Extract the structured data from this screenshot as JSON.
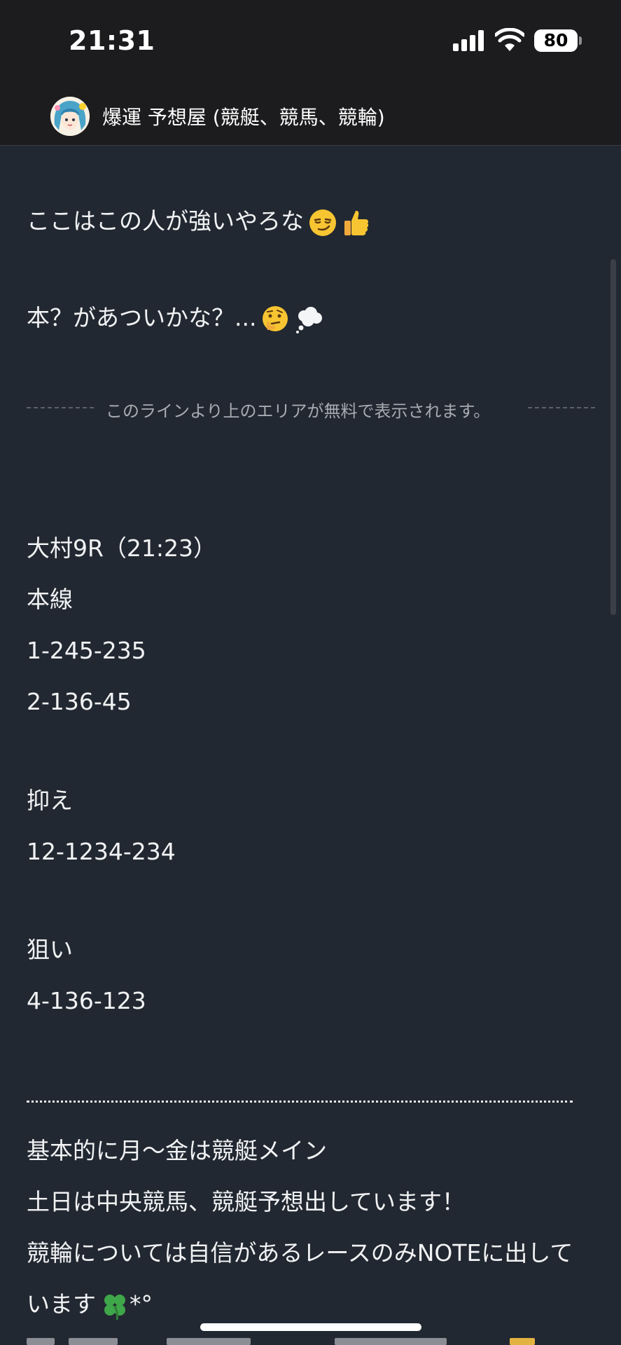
{
  "status_bar": {
    "time": "21:31",
    "battery_level": "80",
    "signal_icon": "cellular-signal-icon",
    "wifi_icon": "wifi-icon",
    "battery_icon": "battery-icon"
  },
  "channel": {
    "name": "爆運 予想屋 (競艇、競馬、競輪)",
    "avatar_icon": "anime-girl-avatar"
  },
  "post": {
    "intro_line_1": "ここはこの人が強いやろな",
    "intro_line_1_emojis": [
      "smirk-emoji",
      "thumbs-up-emoji"
    ],
    "intro_line_2": "本？があついかな？...",
    "intro_line_2_emojis": [
      "thinking-face-emoji",
      "thought-balloon-emoji"
    ],
    "free_area_notice": "このラインより上のエリアが無料で表示されます。",
    "race_title": "大村9R（21:23）",
    "main_label": "本線",
    "main_bet_1": "1-245-235",
    "main_bet_2": "2-136-45",
    "cover_label": "抑え",
    "cover_bet_1": "12-1234-234",
    "target_label": "狙い",
    "target_bet_1": "4-136-123",
    "info_line_1": "基本的に月〜金は競艇メイン",
    "info_line_2": "土日は中央競馬、競艇予想出しています！",
    "info_line_3": "競輪については自信があるレースのみNOTEに出して",
    "info_line_4": "います",
    "info_line_4_suffix": "*°",
    "info_line_4_emoji": "four-leaf-clover-emoji"
  },
  "colors": {
    "background": "#222831",
    "status_bar": "#1c1c1e",
    "text": "#f1f2f4",
    "muted_text": "#a7abb2"
  }
}
